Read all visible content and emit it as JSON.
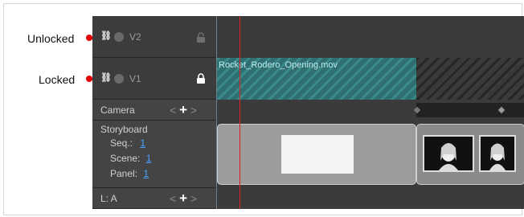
{
  "annotations": {
    "unlocked_label": "Unlocked",
    "locked_label": "Locked",
    "color": "#e30000"
  },
  "layers": {
    "v2": {
      "name": "V2",
      "locked": false
    },
    "v1": {
      "name": "V1",
      "locked": true
    },
    "camera": {
      "name": "Camera"
    },
    "storyboard": {
      "title": "Storyboard",
      "seq_label": "Seq.:",
      "seq_value": "1",
      "scene_label": "Scene:",
      "scene_value": "1",
      "panel_label": "Panel:",
      "panel_value": "1"
    },
    "la": {
      "name": "L: A"
    }
  },
  "tracks": {
    "v1_clip_title": "Rocket_Rodero_Opening.mov"
  },
  "icons": {
    "link": "link-icon",
    "visibility": "visibility-dot-icon",
    "lock_open": "lock-open-icon",
    "lock_closed": "lock-closed-icon",
    "nav_prev": "chevron-left-icon",
    "nav_add": "plus-icon",
    "nav_next": "chevron-right-icon"
  },
  "colors": {
    "playhead": "#e62020",
    "link_value": "#4aa3ff",
    "clip_hatch": "#3a8a8a"
  }
}
